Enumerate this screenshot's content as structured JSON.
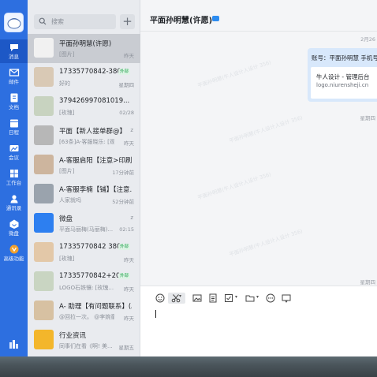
{
  "nav": {
    "items": [
      {
        "label": "消息",
        "icon": "message-icon",
        "active": true
      },
      {
        "label": "邮件",
        "icon": "mail-icon"
      },
      {
        "label": "文档",
        "icon": "document-icon"
      },
      {
        "label": "日程",
        "icon": "calendar-icon"
      },
      {
        "label": "会议",
        "icon": "meeting-icon"
      },
      {
        "label": "工作台",
        "icon": "workbench-icon"
      },
      {
        "label": "通讯录",
        "icon": "contacts-icon"
      },
      {
        "label": "微盘",
        "icon": "cloud-drive-icon"
      },
      {
        "label": "高级功能",
        "icon": "advanced-features-icon"
      }
    ]
  },
  "search": {
    "placeholder": "搜索"
  },
  "add_button": {
    "label": "+"
  },
  "conversations": [
    {
      "name": "平面孙明慧(许愿)",
      "sub": "[图片]",
      "time": "昨天",
      "selected": true
    },
    {
      "name": "17335770842-380...",
      "sub": "好的",
      "time": "星期四",
      "tag": "外部"
    },
    {
      "name": "379426997081019...",
      "sub": "[玫瑰]",
      "time": "02/28"
    },
    {
      "name": "平面【新人接单群@】",
      "sub": "[63条]A-客服晓乐: [观...",
      "time": "昨天",
      "muted": "ᴢ"
    },
    {
      "name": "A-客服启阳【注意>印刷...",
      "sub": "[图片]",
      "time": "17分钟前"
    },
    {
      "name": "A-客服李楠【铺】【注意...",
      "sub": "人家就吗",
      "time": "52分钟前"
    },
    {
      "name": "微盘",
      "sub": "平面马丽梅(马丽梅)...",
      "time": "02:15",
      "muted": "ᴢ"
    },
    {
      "name": "17335770842 380...",
      "sub": "[玫瑰]",
      "time": "昨天",
      "tag": "外部"
    },
    {
      "name": "17335770842+20...",
      "sub": "LOGO石铁镶: [玫瑰...",
      "time": "昨天",
      "tag": "外部"
    },
    {
      "name": "A- 助理【有问题联系】(A...",
      "sub": "@回拉一次。 @李婉童",
      "time": "昨天"
    },
    {
      "name": "行业资讯",
      "sub": "同事们在看《啊! 美...",
      "time": "星期五"
    }
  ],
  "chat": {
    "title": "平面孙明慧(许愿)",
    "date_top": "2月26",
    "card": {
      "header": "账号：平面孙明慧 手机号",
      "title": "牛人设计 - 管理后台",
      "url": "logo.niurensheji.cn"
    },
    "ts1": "星期四",
    "ts2": "星期四",
    "watermark": "平面孙明慧(牛人设计人设计 356)"
  },
  "composer": {
    "tools": [
      "emoji-icon",
      "scissors-icon",
      "image-icon",
      "file-icon",
      "task-icon",
      "folder-icon",
      "more-icon",
      "screen-icon"
    ]
  },
  "colors": {
    "rail": "#2d6fe0",
    "accent": "#2d8cf0",
    "external_tag": "#23a34f"
  }
}
